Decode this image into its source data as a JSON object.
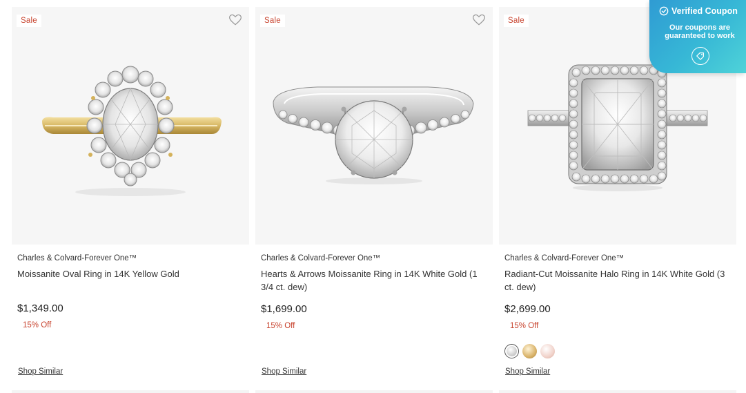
{
  "products": [
    {
      "badge": "Sale",
      "brand": "Charles & Colvard-Forever One™",
      "title": "Moissanite Oval Ring in 14K Yellow Gold",
      "price": "$1,349.00",
      "discount": "15% Off",
      "shop_similar": "Shop Similar",
      "metal": "yellow-gold",
      "image": "oval-halo-ring-yellow-gold",
      "swatches": []
    },
    {
      "badge": "Sale",
      "brand": "Charles & Colvard-Forever One™",
      "title": "Hearts & Arrows Moissanite Ring in 14K White Gold (1 3/4 ct. dew)",
      "price": "$1,699.00",
      "discount": "15% Off",
      "shop_similar": "Shop Similar",
      "metal": "white-gold",
      "image": "round-solitaire-pave-ring-white-gold",
      "swatches": []
    },
    {
      "badge": "Sale",
      "brand": "Charles & Colvard-Forever One™",
      "title": "Radiant-Cut Moissanite Halo Ring in 14K White Gold (3 ct. dew)",
      "price": "$2,699.00",
      "discount": "15% Off",
      "shop_similar": "Shop Similar",
      "metal": "white-gold",
      "image": "radiant-halo-ring-white-gold",
      "swatches": [
        "white-gold",
        "yellow-gold",
        "rose-gold"
      ]
    }
  ],
  "coupon": {
    "title": "Verified Coupon",
    "line1": "Our coupons are",
    "line2": "guaranteed to work",
    "icon": "tag-icon"
  },
  "colors": {
    "sale_red": "#c8442f",
    "card_bg": "#f6f6f6",
    "coupon_gradient_start": "#2f9bd3",
    "coupon_gradient_end": "#4fd3d8"
  }
}
